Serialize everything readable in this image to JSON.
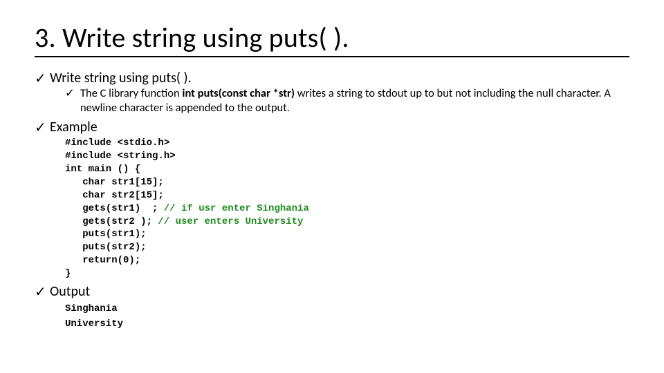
{
  "title": "3. Write string using puts( ).",
  "bullets": {
    "b1": {
      "label": "Write string using puts( ).",
      "sub": {
        "pre": "The C library function ",
        "bold": "int puts(const char *str)",
        "post": " writes a string to stdout up to but not including the null character. A newline character is appended to the output."
      }
    },
    "b2": {
      "label": "Example"
    },
    "b3": {
      "label": "Output"
    }
  },
  "code": {
    "l1": "#include <stdio.h>",
    "l2": "#include <string.h>",
    "l3": "int main () {",
    "l4": "   char str1[15];",
    "l5": "   char str2[15];",
    "l6a": "   gets(str1)  ; ",
    "l6c": "// if usr enter Singhania",
    "l7a": "   gets(str2 ); ",
    "l7c": "// user enters University",
    "l8": "   puts(str1);",
    "l9": "   puts(str2);",
    "l10": "   return(0);",
    "l11": "}"
  },
  "output": {
    "l1": "Singhania",
    "l2": "University"
  }
}
